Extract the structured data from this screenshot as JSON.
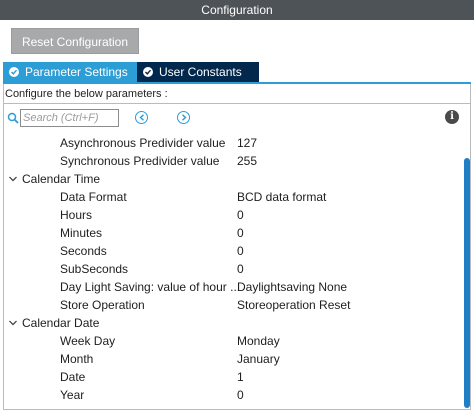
{
  "window": {
    "title": "Configuration"
  },
  "toolbar": {
    "reset_label": "Reset Configuration"
  },
  "tabs": [
    {
      "label": "Parameter Settings",
      "active": true
    },
    {
      "label": "User Constants",
      "active": false
    }
  ],
  "hint": "Configure the below parameters :",
  "search": {
    "placeholder": "Search (Ctrl+F)"
  },
  "rows": [
    {
      "label": "Asynchronous Predivider value",
      "value": "127"
    },
    {
      "label": "Synchronous Predivider value",
      "value": "255"
    },
    {
      "group": "Calendar Time"
    },
    {
      "label": "Data Format",
      "value": "BCD data format"
    },
    {
      "label": "Hours",
      "value": "0"
    },
    {
      "label": "Minutes",
      "value": "0"
    },
    {
      "label": "Seconds",
      "value": "0"
    },
    {
      "label": "SubSeconds",
      "value": "0"
    },
    {
      "label": "Day Light Saving: value of hour ...",
      "value": "Daylightsaving None"
    },
    {
      "label": "Store Operation",
      "value": "Storeoperation Reset"
    },
    {
      "group": "Calendar Date"
    },
    {
      "label": "Week Day",
      "value": "Monday"
    },
    {
      "label": "Month",
      "value": "January"
    },
    {
      "label": "Date",
      "value": "1"
    },
    {
      "label": "Year",
      "value": "0"
    }
  ],
  "icons": {
    "search": "search-icon",
    "prev": "prev-icon",
    "next": "next-icon",
    "info": "info-icon"
  },
  "colors": {
    "accent": "#2c9dd5",
    "tab_dark": "#02284d",
    "titlebar": "#4e5358"
  }
}
